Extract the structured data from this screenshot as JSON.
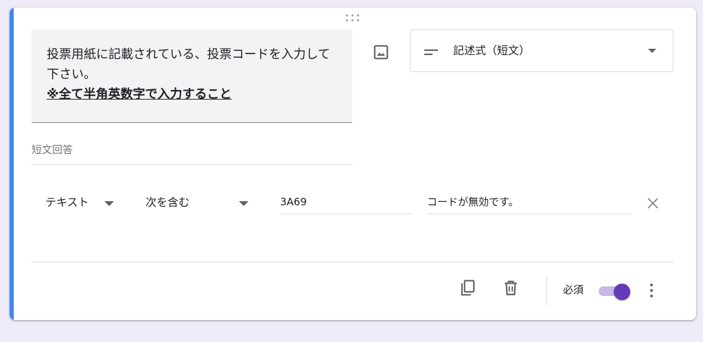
{
  "question": {
    "text": "投票用紙に記載されている、投票コードを入力して下さい。",
    "note": "※全て半角英数字で入力すること"
  },
  "question_type": {
    "label": "記述式（短文）",
    "icon": "short-text-icon"
  },
  "answer_preview": {
    "placeholder": "短文回答"
  },
  "validation": {
    "type": "テキスト",
    "condition": "次を含む",
    "value": "3A69",
    "error_text": "コードが無効です。"
  },
  "footer": {
    "required_label": "必須",
    "required_on": true
  },
  "colors": {
    "accent_bar": "#4285f4",
    "toggle_thumb": "#673ab7",
    "toggle_track": "#c5b8e7",
    "page_background": "#f0ebf8"
  }
}
